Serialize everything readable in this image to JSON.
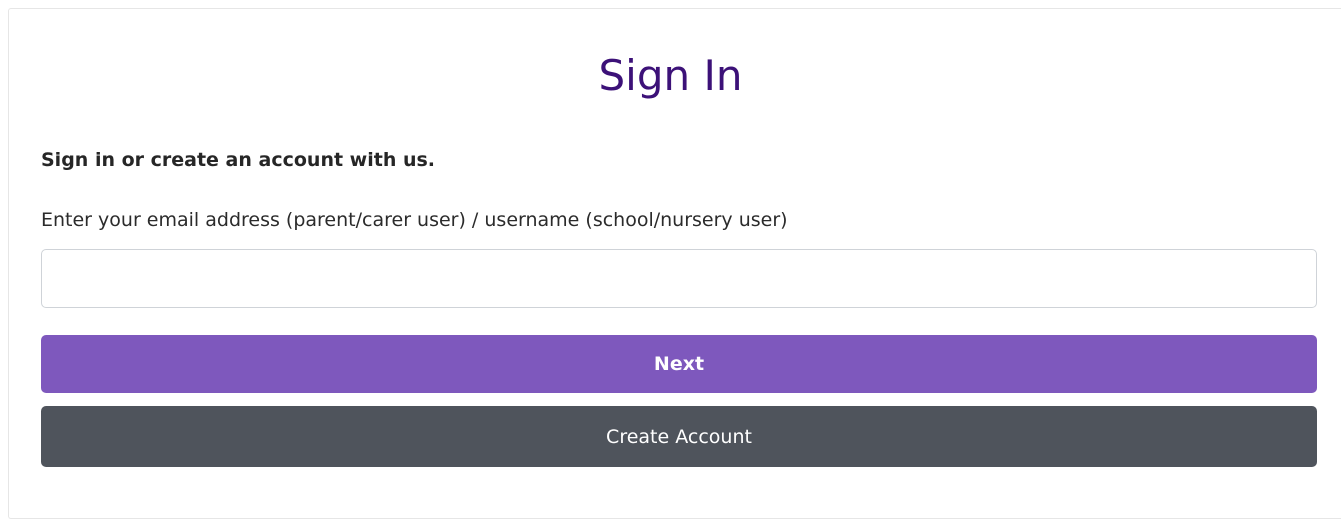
{
  "signin": {
    "title": "Sign In",
    "subtitle": "Sign in or create an account with us.",
    "field_label": "Enter your email address (parent/carer user) / username (school/nursery user)",
    "input_value": "",
    "next_label": "Next",
    "create_label": "Create Account"
  },
  "colors": {
    "title": "#3c1178",
    "next_button": "#7e58bd",
    "create_button": "#4f545c"
  }
}
